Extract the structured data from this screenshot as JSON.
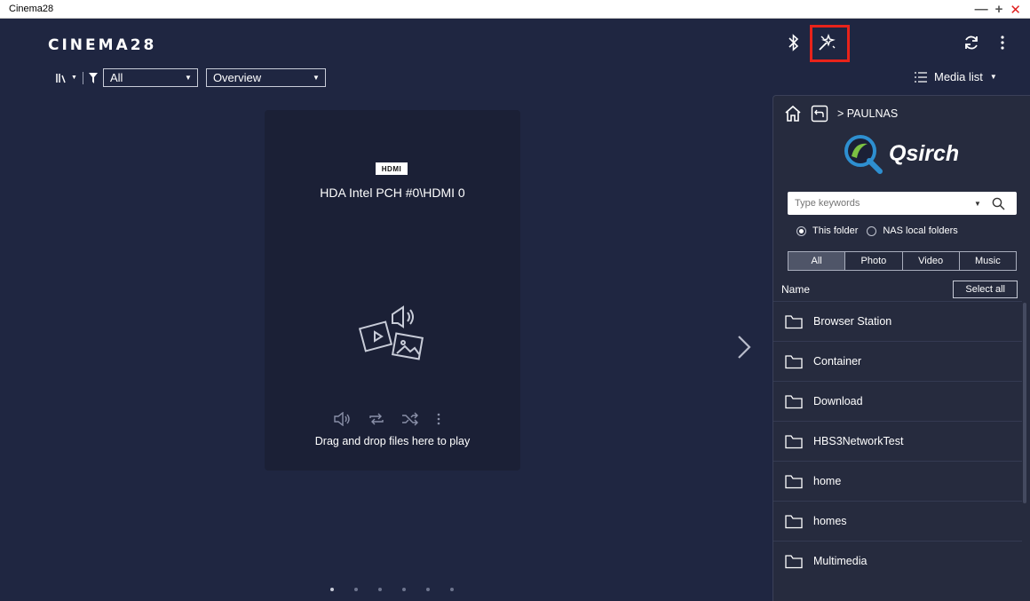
{
  "window": {
    "title": "Cinema28",
    "minimize": "—",
    "maximize": "+",
    "close": "✕"
  },
  "header": {
    "logo": "CINEMA28"
  },
  "icons": {
    "bluetooth": "bluetooth-icon",
    "magic": "wand-icon",
    "refresh": "refresh-icon",
    "more": "more-vertical-icon"
  },
  "toolbar": {
    "filter_value": "All",
    "view_value": "Overview"
  },
  "media_list": {
    "label": "Media list"
  },
  "player": {
    "hdmi_badge": "HDMI",
    "device_name": "HDA Intel PCH #0\\HDMI 0",
    "drop_text": "Drag and drop files here to play"
  },
  "panel": {
    "breadcrumb": "> PAULNAS",
    "qsirch": "Qsirch",
    "search_placeholder": "Type keywords",
    "radios": [
      {
        "label": "This folder",
        "checked": true
      },
      {
        "label": "NAS local folders",
        "checked": false
      }
    ],
    "tabs": [
      {
        "label": "All",
        "active": true
      },
      {
        "label": "Photo",
        "active": false
      },
      {
        "label": "Video",
        "active": false
      },
      {
        "label": "Music",
        "active": false
      }
    ],
    "name_header": "Name",
    "select_all": "Select all",
    "folders": [
      "Browser Station",
      "Container",
      "Download",
      "HBS3NetworkTest",
      "home",
      "homes",
      "Multimedia"
    ]
  },
  "pager": {
    "count": 6,
    "active": 0
  }
}
